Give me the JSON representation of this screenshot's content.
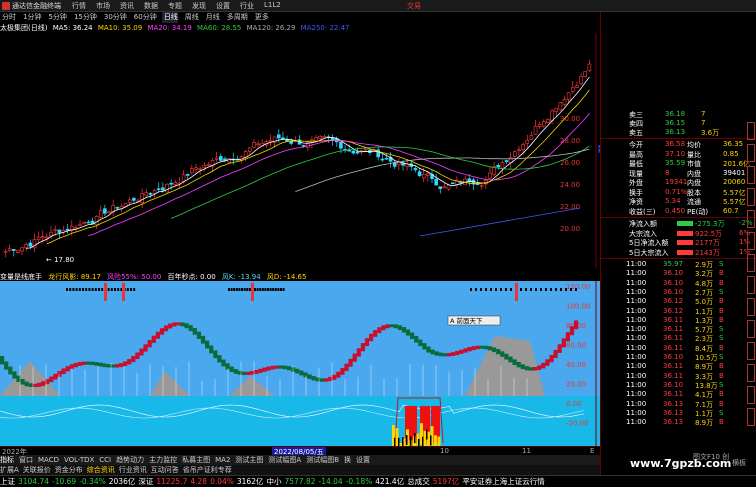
{
  "titlebar": {
    "app": "通达信金融终端",
    "menu": [
      "行情",
      "市场",
      "资讯",
      "数据",
      "专题",
      "发现",
      "设置",
      "行业",
      "L1L2"
    ],
    "right": "交易"
  },
  "periods": [
    "分时",
    "1分钟",
    "5分钟",
    "15分钟",
    "30分钟",
    "60分钟",
    "日线",
    "周线",
    "月线",
    "多周期",
    "更多"
  ],
  "active_period": "日线",
  "ma": {
    "name": "太极集团(日线)",
    "ma5": "MA5: 36.24",
    "ma10": "MA10: 35.09",
    "ma20": "MA20: 34.19",
    "ma60": "MA60: 28.55",
    "ma120": "MA120: 26.29",
    "ma250": "MA250: 22.47"
  },
  "price_axis": [
    "30.00",
    "28.00",
    "26.00",
    "24.00",
    "22.00",
    "20.00"
  ],
  "price_axis_tag": "28.96",
  "low_marker": "17.80",
  "indicator_bar": {
    "name": "变量是线底手",
    "a": "龙行风影: 89.17",
    "b": "风险55%: 50.00",
    "c": "百年秒点: 0.00",
    "d": "风K: -13.94",
    "e": "风D: -14.65"
  },
  "ind_axis": [
    "120.00",
    "100.00",
    "80.00",
    "60.00",
    "40.00",
    "20.00",
    "0.00",
    "-20.00"
  ],
  "ind_label": "A 前面天下",
  "xaxis": {
    "start": "2022年",
    "date": "2022/08/05/五",
    "m1": "10",
    "m2": "11",
    "e": "E"
  },
  "tabs": [
    "指标",
    "窗口",
    "MACD",
    "VOL-TDX",
    "CCI",
    "趋势动力",
    "主力监控",
    "私募主图",
    "MA2",
    "测试主图",
    "测试幅图A",
    "测试幅图B",
    "换",
    "设置"
  ],
  "toolbar2": [
    "扩展A",
    "关联报价",
    "资金分布",
    "综合资讯",
    "行业资讯",
    "互动问答",
    "省吊产证利专荐"
  ],
  "status": [
    {
      "name": "上证",
      "value": "3104.74",
      "chg": "-10.69",
      "pct": "-0.34%",
      "vol": "2036亿"
    },
    {
      "name": "深证",
      "value": "11225.7",
      "chg": "4.28",
      "pct": "0.04%",
      "vol": "3162亿"
    },
    {
      "name": "中小",
      "value": "7577.82",
      "chg": "-14.04",
      "pct": "-0.18%",
      "vol": "421.4亿"
    },
    {
      "name": "总成交",
      "value": "5197亿"
    }
  ],
  "status_right": "平安证券上海上证云行情",
  "watermark": "www.7gpzb.com",
  "corner": "图文F10 创",
  "quote": {
    "sells": [
      {
        "l": "卖三",
        "p": "36.18",
        "v": "7"
      },
      {
        "l": "卖四",
        "p": "36.15",
        "v": "7"
      },
      {
        "l": "卖五",
        "p": "36.13",
        "v": "3.6万"
      }
    ],
    "rows": [
      {
        "a": "今开",
        "b": "36.58",
        "c": "均价",
        "d": "36.35"
      },
      {
        "a": "最高",
        "b": "37.10",
        "c": "量比",
        "d": "0.85"
      },
      {
        "a": "最低",
        "b": "35.59",
        "c": "市值",
        "d": "201.6亿"
      },
      {
        "a": "现量",
        "b": "8",
        "c": "内盘",
        "d": "39401"
      },
      {
        "a": "外盘",
        "b": "19341",
        "c": "内盘",
        "d": "20060"
      },
      {
        "a": "换手",
        "b": "0.71%",
        "c": "股本",
        "d": "5.57亿"
      },
      {
        "a": "净资",
        "b": "5.34",
        "c": "流通",
        "d": "5.57亿"
      },
      {
        "a": "收益(三)",
        "b": "0.450",
        "c": "PE(动)",
        "d": "60.7"
      }
    ],
    "flow": [
      {
        "a": "净流入额",
        "b": "-275.3万",
        "c": "-2%"
      },
      {
        "a": "大宗流入",
        "b": "922.5万",
        "c": "6%"
      },
      {
        "a": "5日净流入额",
        "b": "2177万",
        "c": "1%"
      },
      {
        "a": "5日大宗流入",
        "b": "2143万",
        "c": "1%"
      }
    ],
    "ticks": [
      {
        "t": "11:00",
        "p": "35.97",
        "v": "2.9万",
        "d": "S"
      },
      {
        "t": "11:00",
        "p": "36.10",
        "v": "3.2万",
        "d": "B"
      },
      {
        "t": "11:00",
        "p": "36.10",
        "v": "4.8万",
        "d": "B"
      },
      {
        "t": "11:00",
        "p": "36.10",
        "v": "2.7万",
        "d": "S"
      },
      {
        "t": "11:00",
        "p": "36.12",
        "v": "5.0万",
        "d": "B"
      },
      {
        "t": "11:00",
        "p": "36.12",
        "v": "1.1万",
        "d": "B"
      },
      {
        "t": "11:00",
        "p": "36.11",
        "v": "1.3万",
        "d": "B"
      },
      {
        "t": "11:00",
        "p": "36.11",
        "v": "5.7万",
        "d": "S"
      },
      {
        "t": "11:00",
        "p": "36.11",
        "v": "2.3万",
        "d": "S"
      },
      {
        "t": "11:00",
        "p": "36.11",
        "v": "8.4万",
        "d": "B"
      },
      {
        "t": "11:00",
        "p": "36.10",
        "v": "10.5万",
        "d": "S"
      },
      {
        "t": "11:00",
        "p": "36.11",
        "v": "8.9万",
        "d": "B"
      },
      {
        "t": "11:00",
        "p": "36.11",
        "v": "3.3万",
        "d": "B"
      },
      {
        "t": "11:00",
        "p": "36.10",
        "v": "13.8万",
        "d": "S"
      },
      {
        "t": "11:00",
        "p": "36.11",
        "v": "4.1万",
        "d": "B"
      },
      {
        "t": "11:00",
        "p": "36.13",
        "v": "7.1万",
        "d": "B"
      },
      {
        "t": "11:00",
        "p": "36.13",
        "v": "1.1万",
        "d": "S"
      },
      {
        "t": "11:00",
        "p": "36.13",
        "v": "8.9万",
        "d": "B"
      }
    ],
    "tick_tab": "横板"
  }
}
